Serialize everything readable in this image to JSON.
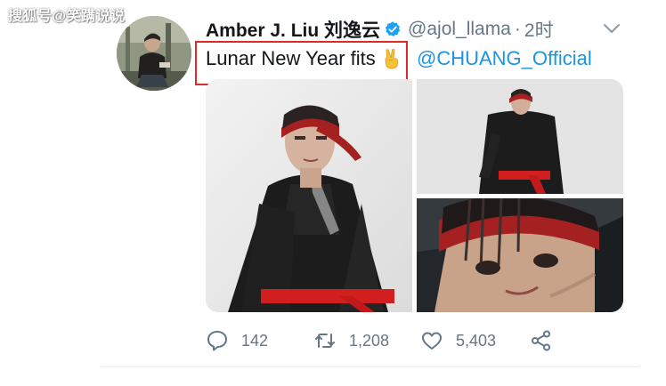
{
  "watermark": "搜狐号@笑蹒说说",
  "tweet": {
    "author": {
      "display_name": "Amber J. Liu 刘逸云",
      "verified": true,
      "handle": "@ajol_llama",
      "separator": "·",
      "time": "2时"
    },
    "text": "Lunar New Year fits",
    "emoji": "victory-hand-emoji",
    "mention": "@CHUANG_Official",
    "media_count": 3,
    "stats": {
      "replies": "142",
      "retweets": "1,208",
      "likes": "5,403"
    }
  },
  "icons": {
    "verified": "verified-badge-icon",
    "caret": "chevron-down-icon",
    "reply": "reply-icon",
    "retweet": "retweet-icon",
    "like": "heart-icon",
    "share": "share-icon"
  },
  "colors": {
    "verified_blue": "#1da1f2",
    "mention_blue": "#1b95e0",
    "secondary_text": "#657786",
    "annotation_red": "#e02a2a"
  }
}
